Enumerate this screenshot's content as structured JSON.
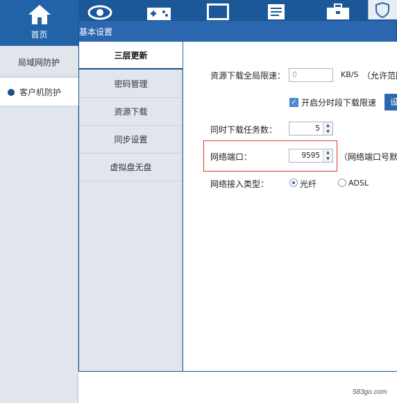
{
  "nav": {
    "home_label": "首页",
    "icons": [
      "home-icon",
      "eye-icon",
      "gamepad-icon",
      "window-icon",
      "document-icon",
      "toolbox-icon",
      "shield-icon"
    ]
  },
  "sidebar": {
    "items": [
      {
        "label": "局域网防护",
        "selected": false
      },
      {
        "label": "客户机防护",
        "selected": true
      }
    ]
  },
  "dialog": {
    "title": "基本设置",
    "tabs": [
      {
        "label": "三层更新",
        "active": true
      },
      {
        "label": "密码管理",
        "active": false
      },
      {
        "label": "资源下载",
        "active": false
      },
      {
        "label": "同步设置",
        "active": false
      },
      {
        "label": "虚拟盘无盘",
        "active": false
      }
    ],
    "settings": {
      "global_speed_label": "资源下载全局限速：",
      "global_speed_placeholder": "0",
      "speed_unit": "KB/S",
      "speed_hint": "（允许范围",
      "timed_limit_label": "开启分时段下载限速",
      "timed_limit_checked": true,
      "set_button_label": "设",
      "concurrent_label": "同时下载任务数：",
      "concurrent_value": "5",
      "port_label": "网络端口：",
      "port_value": "9595",
      "port_hint": "（网络端口号默认",
      "access_type_label": "网络接入类型：",
      "access_options": [
        {
          "label": "光纤",
          "selected": true
        },
        {
          "label": "ADSL",
          "selected": false
        }
      ]
    }
  },
  "watermark": "583go.com",
  "colors": {
    "topbar": "#1c5897",
    "dialog_header": "#2a67ae",
    "highlight": "#e03434",
    "panel_bg": "#e1e5ec"
  }
}
